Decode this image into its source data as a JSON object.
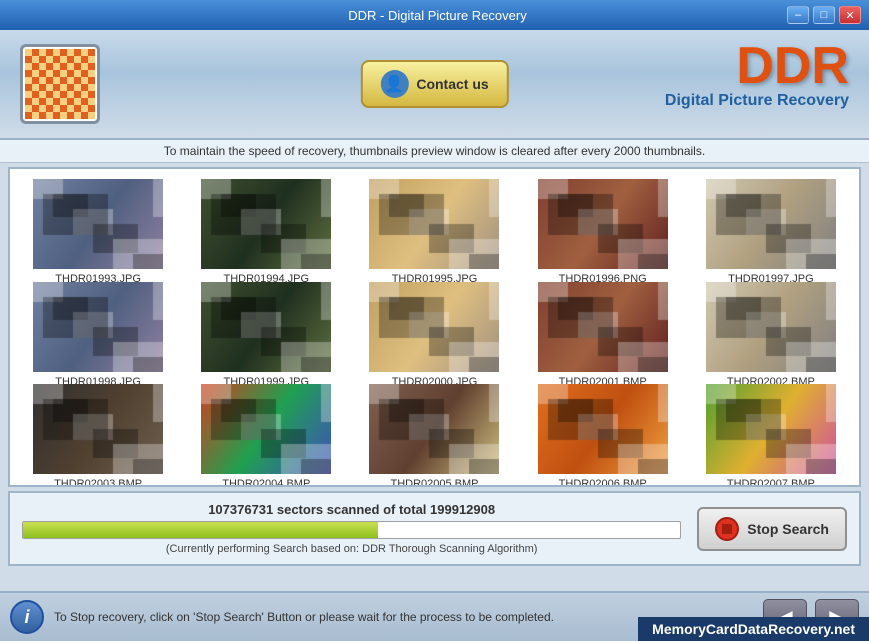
{
  "titlebar": {
    "title": "DDR - Digital Picture Recovery",
    "min_label": "–",
    "max_label": "□",
    "close_label": "✕"
  },
  "header": {
    "contact_label": "Contact us",
    "ddr_text": "DDR",
    "ddr_subtitle": "Digital Picture Recovery"
  },
  "info_bar": {
    "message": "To maintain the speed of recovery, thumbnails preview window is cleared after every 2000 thumbnails."
  },
  "thumbnails": [
    {
      "name": "THDR01993.JPG",
      "style": "thumb-people"
    },
    {
      "name": "THDR01994.JPG",
      "style": "thumb-green"
    },
    {
      "name": "THDR01995.JPG",
      "style": "thumb-desert"
    },
    {
      "name": "THDR01996.PNG",
      "style": "thumb-interior"
    },
    {
      "name": "THDR01997.JPG",
      "style": "thumb-bright"
    },
    {
      "name": "THDR01998.JPG",
      "style": "thumb-people"
    },
    {
      "name": "THDR01999.JPG",
      "style": "thumb-green"
    },
    {
      "name": "THDR02000.JPG",
      "style": "thumb-desert"
    },
    {
      "name": "THDR02001.BMP",
      "style": "thumb-interior"
    },
    {
      "name": "THDR02002.BMP",
      "style": "thumb-bright"
    },
    {
      "name": "THDR02003.BMP",
      "style": "thumb-dark"
    },
    {
      "name": "THDR02004.BMP",
      "style": "thumb-colorful"
    },
    {
      "name": "THDR02005.BMP",
      "style": "thumb-indoor"
    },
    {
      "name": "THDR02006.BMP",
      "style": "thumb-group"
    },
    {
      "name": "THDR02007.BMP",
      "style": "thumb-flowers"
    }
  ],
  "status": {
    "sectors_text": "107376731 sectors scanned of total 199912908",
    "progress_percent": 54,
    "algo_text": "(Currently performing Search based on:  DDR Thorough Scanning Algorithm)",
    "stop_label": "Stop Search"
  },
  "footer": {
    "info_text": "To Stop recovery, click on 'Stop Search' Button or please wait for the process to be completed.",
    "info_icon": "i",
    "prev_icon": "◀",
    "next_icon": "▶"
  },
  "brand": {
    "text": "MemoryCardDataRecovery.net"
  }
}
